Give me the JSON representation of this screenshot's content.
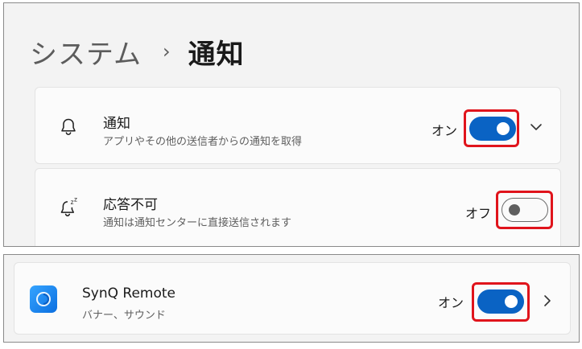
{
  "breadcrumb": {
    "parent": "システム",
    "separator": "›",
    "current": "通知"
  },
  "notifications": {
    "icon": "bell-icon",
    "title": "通知",
    "description": "アプリやその他の送信者からの通知を取得",
    "state_label": "オン",
    "toggle_on": true,
    "expand_icon": "chevron-down-icon"
  },
  "do_not_disturb": {
    "icon": "bell-snooze-icon",
    "title": "応答不可",
    "description": "通知は通知センターに直接送信されます",
    "state_label": "オフ",
    "toggle_on": false
  },
  "app_entry": {
    "icon": "synq-remote-app-icon",
    "name": "SynQ Remote",
    "description": "バナー、サウンド",
    "state_label": "オン",
    "toggle_on": true,
    "navigate_icon": "chevron-right-icon"
  },
  "colors": {
    "toggle_on": "#0a63c4",
    "highlight": "#e0141c",
    "background": "#f3f3f3",
    "card": "#fbfbfb"
  }
}
